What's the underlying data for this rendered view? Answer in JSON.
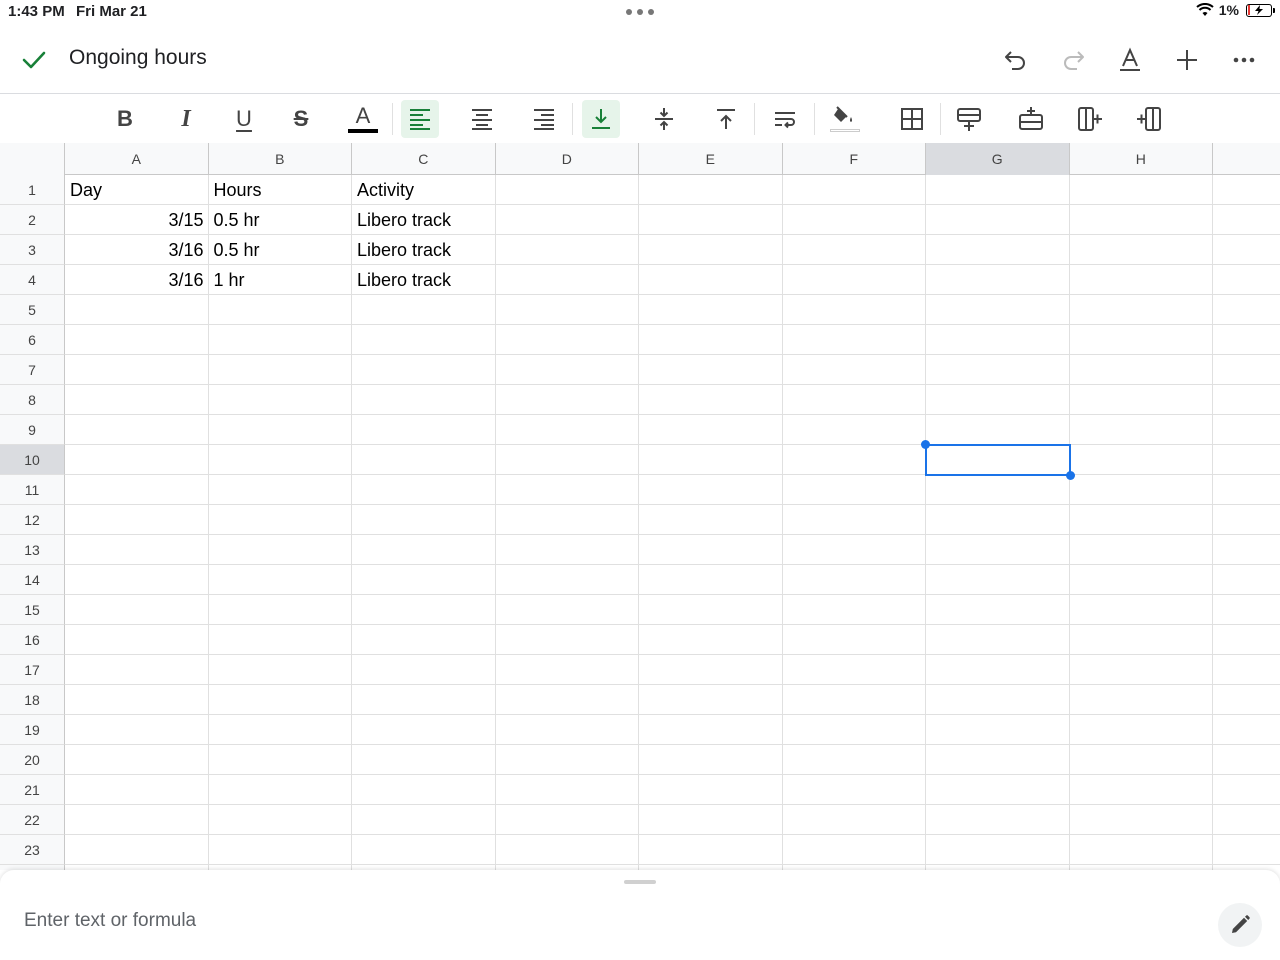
{
  "status_bar": {
    "time": "1:43 PM",
    "date": "Fri Mar 21",
    "battery_percent": "1%"
  },
  "app_bar": {
    "title": "Ongoing hours",
    "icons": [
      "check-icon",
      "undo-icon",
      "redo-icon",
      "text-format-icon",
      "add-icon",
      "more-icon"
    ]
  },
  "toolbar": {
    "buttons": [
      "bold",
      "italic",
      "underline",
      "strikethrough",
      "text-color",
      "align-left",
      "align-center",
      "align-right",
      "valign-bottom",
      "valign-middle",
      "valign-top",
      "wrap-text",
      "fill-color",
      "borders",
      "insert-row-above",
      "insert-row-below",
      "insert-column-left",
      "insert-column-right"
    ],
    "active": [
      "align-left",
      "valign-bottom"
    ],
    "bold_label": "B",
    "italic_label": "I",
    "underline_label": "U",
    "strike_label": "S",
    "text_color_label": "A",
    "accent_color": "#188038"
  },
  "sheet": {
    "columns": [
      "A",
      "B",
      "C",
      "D",
      "E",
      "F",
      "G",
      "H"
    ],
    "rows": [
      "1",
      "2",
      "3",
      "4",
      "5",
      "6",
      "7",
      "8",
      "9",
      "10",
      "11",
      "12",
      "13",
      "14",
      "15",
      "16",
      "17",
      "18",
      "19",
      "20",
      "21",
      "22",
      "23"
    ],
    "selected_column": "G",
    "selected_row": "10",
    "selected_cell": "G10",
    "selection_color": "#1a73e8",
    "cells": {
      "A1": "Day",
      "B1": "Hours",
      "C1": "Activity",
      "A2": "3/15",
      "B2": "0.5 hr",
      "C2": "Libero track",
      "A3": "3/16",
      "B3": "0.5 hr",
      "C3": "Libero track",
      "A4": "3/16",
      "B4": "1 hr",
      "C4": "Libero track"
    }
  },
  "formula_bar": {
    "placeholder": "Enter text or formula",
    "value": ""
  }
}
